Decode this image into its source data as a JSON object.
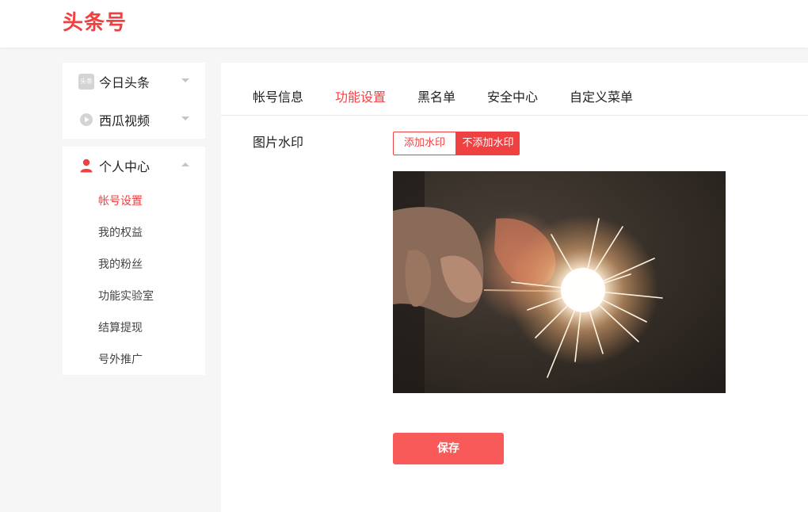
{
  "header": {
    "logo_text": "头条号"
  },
  "sidebar": {
    "groups": [
      {
        "label": "今日头条",
        "icon": "toutiao-icon",
        "icon_text": "头条"
      },
      {
        "label": "西瓜视频",
        "icon": "xigua-video-icon"
      }
    ],
    "personal": {
      "label": "个人中心",
      "icon": "user-icon",
      "items": [
        {
          "label": "帐号设置",
          "active": true
        },
        {
          "label": "我的权益"
        },
        {
          "label": "我的粉丝"
        },
        {
          "label": "功能实验室"
        },
        {
          "label": "结算提现"
        },
        {
          "label": "号外推广"
        }
      ]
    }
  },
  "tabs": [
    {
      "label": "帐号信息"
    },
    {
      "label": "功能设置",
      "active": true
    },
    {
      "label": "黑名单"
    },
    {
      "label": "安全中心"
    },
    {
      "label": "自定义菜单"
    }
  ],
  "watermark": {
    "label": "图片水印",
    "options": [
      "添加水印",
      "不添加水印"
    ],
    "selected": "不添加水印"
  },
  "save_label": "保存",
  "colors": {
    "accent": "#f04142",
    "save_button": "#f85959"
  }
}
